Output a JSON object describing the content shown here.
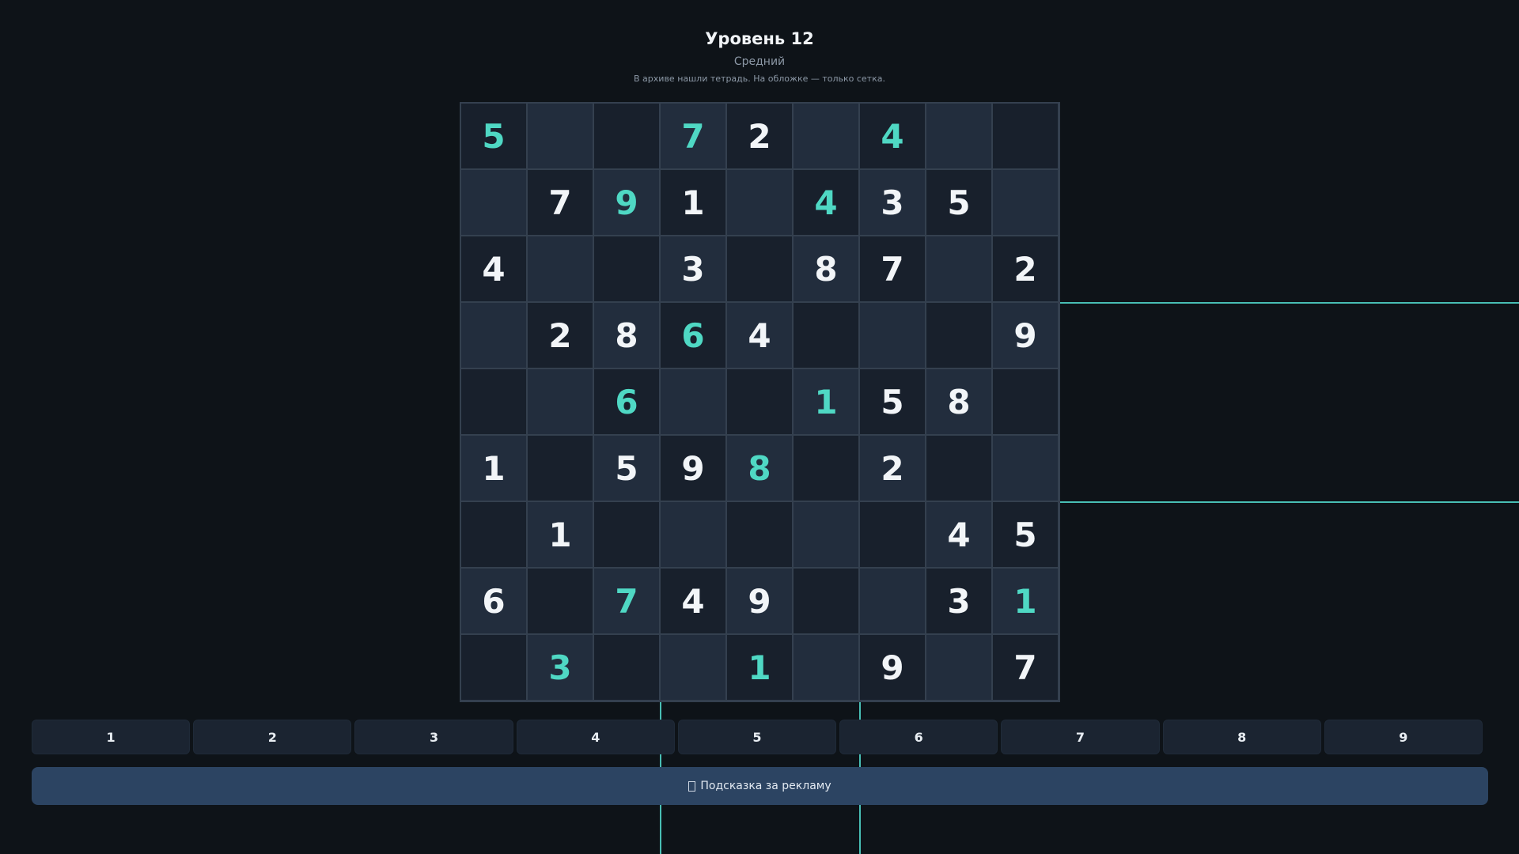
{
  "header": {
    "title": "Уровень 12",
    "difficulty": "Средний",
    "story": "В архиве нашли тетрадь. На обложке — только сетка."
  },
  "board": {
    "rows": [
      [
        {
          "v": "5",
          "teal": true
        },
        {
          "v": "",
          "teal": false
        },
        {
          "v": "",
          "teal": false
        },
        {
          "v": "7",
          "teal": true
        },
        {
          "v": "2",
          "teal": false
        },
        {
          "v": "",
          "teal": false
        },
        {
          "v": "4",
          "teal": true
        },
        {
          "v": "",
          "teal": false
        },
        {
          "v": "",
          "teal": false
        }
      ],
      [
        {
          "v": "",
          "teal": false
        },
        {
          "v": "7",
          "teal": false
        },
        {
          "v": "9",
          "teal": true
        },
        {
          "v": "1",
          "teal": false
        },
        {
          "v": "",
          "teal": false
        },
        {
          "v": "4",
          "teal": true
        },
        {
          "v": "3",
          "teal": false
        },
        {
          "v": "5",
          "teal": false
        },
        {
          "v": "",
          "teal": false
        }
      ],
      [
        {
          "v": "4",
          "teal": false
        },
        {
          "v": "",
          "teal": false
        },
        {
          "v": "",
          "teal": false
        },
        {
          "v": "3",
          "teal": false
        },
        {
          "v": "",
          "teal": false
        },
        {
          "v": "8",
          "teal": false
        },
        {
          "v": "7",
          "teal": false
        },
        {
          "v": "",
          "teal": false
        },
        {
          "v": "2",
          "teal": false
        }
      ],
      [
        {
          "v": "",
          "teal": false
        },
        {
          "v": "2",
          "teal": false
        },
        {
          "v": "8",
          "teal": false
        },
        {
          "v": "6",
          "teal": true
        },
        {
          "v": "4",
          "teal": false
        },
        {
          "v": "",
          "teal": false
        },
        {
          "v": "",
          "teal": false
        },
        {
          "v": "",
          "teal": false
        },
        {
          "v": "9",
          "teal": false
        }
      ],
      [
        {
          "v": "",
          "teal": false
        },
        {
          "v": "",
          "teal": false
        },
        {
          "v": "6",
          "teal": true
        },
        {
          "v": "",
          "teal": false
        },
        {
          "v": "",
          "teal": false
        },
        {
          "v": "1",
          "teal": true
        },
        {
          "v": "5",
          "teal": false
        },
        {
          "v": "8",
          "teal": false
        },
        {
          "v": "",
          "teal": false
        }
      ],
      [
        {
          "v": "1",
          "teal": false
        },
        {
          "v": "",
          "teal": false
        },
        {
          "v": "5",
          "teal": false
        },
        {
          "v": "9",
          "teal": false
        },
        {
          "v": "8",
          "teal": true
        },
        {
          "v": "",
          "teal": false
        },
        {
          "v": "2",
          "teal": false
        },
        {
          "v": "",
          "teal": false
        },
        {
          "v": "",
          "teal": false
        }
      ],
      [
        {
          "v": "",
          "teal": false
        },
        {
          "v": "1",
          "teal": false
        },
        {
          "v": "",
          "teal": false
        },
        {
          "v": "",
          "teal": false
        },
        {
          "v": "",
          "teal": false
        },
        {
          "v": "",
          "teal": false
        },
        {
          "v": "",
          "teal": false
        },
        {
          "v": "4",
          "teal": false
        },
        {
          "v": "5",
          "teal": false
        }
      ],
      [
        {
          "v": "6",
          "teal": false
        },
        {
          "v": "",
          "teal": false
        },
        {
          "v": "7",
          "teal": true
        },
        {
          "v": "4",
          "teal": false
        },
        {
          "v": "9",
          "teal": false
        },
        {
          "v": "",
          "teal": false
        },
        {
          "v": "",
          "teal": false
        },
        {
          "v": "3",
          "teal": false
        },
        {
          "v": "1",
          "teal": true
        }
      ],
      [
        {
          "v": "",
          "teal": false
        },
        {
          "v": "3",
          "teal": true
        },
        {
          "v": "",
          "teal": false
        },
        {
          "v": "",
          "teal": false
        },
        {
          "v": "1",
          "teal": true
        },
        {
          "v": "",
          "teal": false
        },
        {
          "v": "9",
          "teal": false
        },
        {
          "v": "",
          "teal": false
        },
        {
          "v": "7",
          "teal": false
        }
      ]
    ]
  },
  "numpad": [
    "1",
    "2",
    "3",
    "4",
    "5",
    "6",
    "7",
    "8",
    "9"
  ],
  "hint": {
    "label": "Подсказка за рекламу",
    "icon": "missing-glyph-icon"
  },
  "colors": {
    "background": "#0e1318",
    "cell_dark": "#18202c",
    "cell_light": "#222d3d",
    "accent_teal": "#4fd8c4",
    "hint_button": "#2c4462"
  }
}
